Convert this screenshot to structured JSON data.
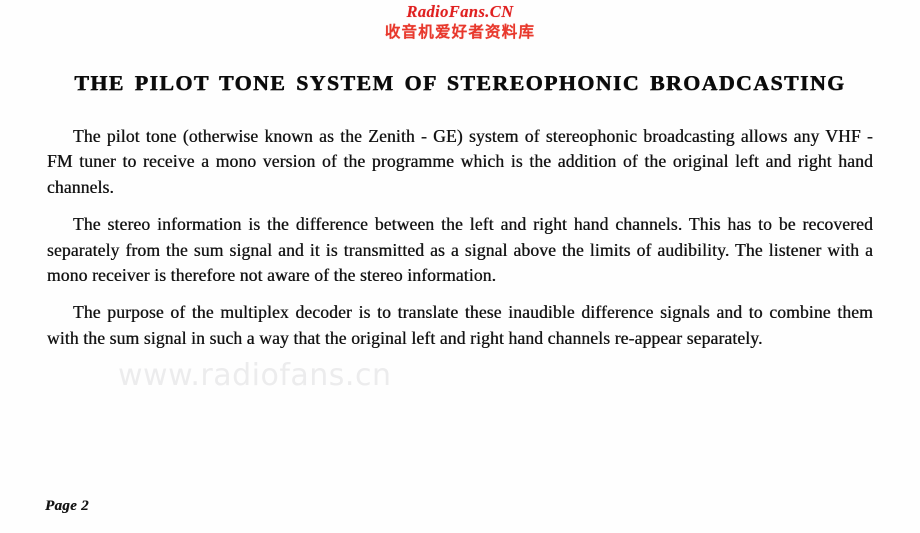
{
  "banner": {
    "latin_text": "RadioFans.CN",
    "cjk_text": "收音机爱好者资料库",
    "color": "#e02020"
  },
  "document": {
    "title": "THE PILOT TONE SYSTEM OF STEREOPHONIC BROADCASTING",
    "paragraphs": [
      "The pilot tone (otherwise known as the Zenith - GE) system of stereophonic broadcasting allows any VHF - FM tuner to receive a mono version of the programme which is the addition of the original left and right hand channels.",
      "The stereo information is the difference between the left and right hand channels.  This has to be recovered separately from the sum signal and it is transmitted as a signal above the limits of audibility.  The listener with a mono receiver is therefore not aware of the stereo information.",
      "The purpose of the multiplex decoder is to translate these inaudible difference signals and to combine them with the sum signal in such a way that the original left and right hand channels re-appear separately."
    ],
    "text_color": "#121212"
  },
  "watermark": {
    "text": "www.radiofans.cn",
    "color": "#ececed"
  },
  "footer": {
    "page_label": "Page 2"
  }
}
